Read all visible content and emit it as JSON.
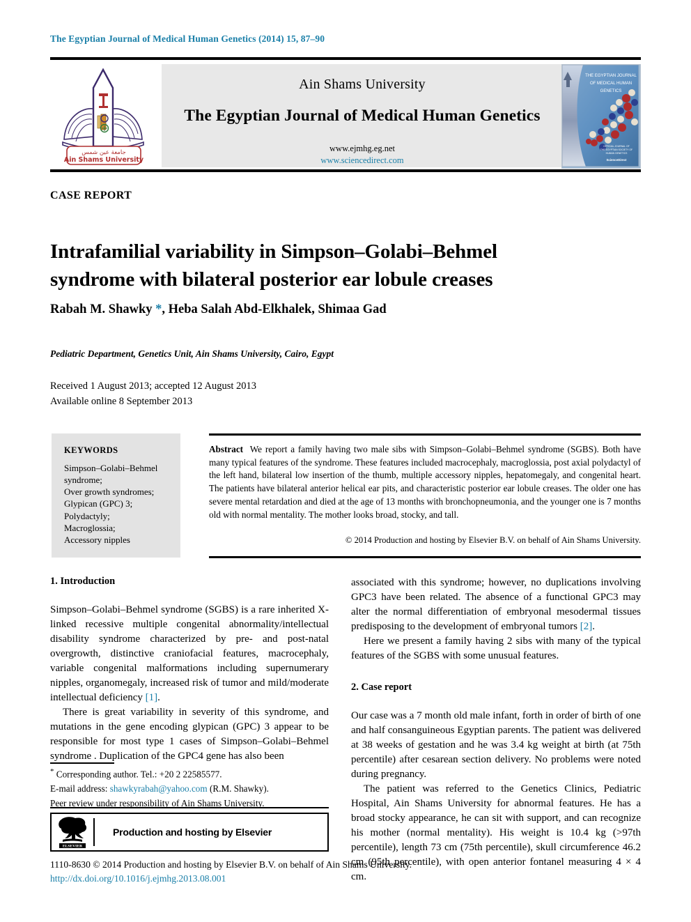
{
  "running_head": "The Egyptian Journal of Medical Human Genetics (2014) 15, 87–90",
  "masthead": {
    "university": "Ain Shams University",
    "journal_title": "The Egyptian Journal of Medical Human Genetics",
    "url_journal": "www.ejmhg.eg.net",
    "url_sciencedirect": "www.sciencedirect.com",
    "logo_caption_arabic": "جامعة عين شمس",
    "logo_caption": "Ain Shams University",
    "cover_title_line1": "THE EGYPTIAN JOURNAL",
    "cover_title_line2": "OF MEDICAL HUMAN",
    "cover_title_line3": "GENETICS"
  },
  "article": {
    "type_label": "CASE REPORT",
    "title": "Intrafamilial variability in Simpson–Golabi–Behmel syndrome with bilateral posterior ear lobule creases",
    "authors_before_star": "Rabah M. Shawky ",
    "author_star": "*",
    "authors_after_star": ", Heba Salah Abd-Elkhalek, Shimaa Gad",
    "affiliation": "Pediatric Department, Genetics Unit, Ain Shams University, Cairo, Egypt",
    "received_line": "Received 1 August 2013; accepted 12 August 2013",
    "available_line": "Available online 8 September 2013"
  },
  "keywords": {
    "heading": "KEYWORDS",
    "items": [
      "Simpson–Golabi–Behmel syndrome;",
      "Over growth syndromes;",
      "Glypican (GPC) 3;",
      "Polydactyly;",
      "Macroglossia;",
      "Accessory nipples"
    ]
  },
  "abstract": {
    "label": "Abstract",
    "text": "We report a family having two male sibs with Simpson–Golabi–Behmel syndrome (SGBS). Both have many typical features of the syndrome. These features included macrocephaly, macroglossia, post axial polydactyl of the left hand, bilateral low insertion of the thumb, multiple accessory nipples, hepatomegaly, and congenital heart. The patients have bilateral anterior helical ear pits, and characteristic posterior ear lobule creases. The older one has severe mental retardation and died at the age of 13 months with bronchopneumonia, and the younger one is 7 months old with normal mentality. The mother looks broad, stocky, and tall.",
    "copyright": "© 2014 Production and hosting by Elsevier B.V. on behalf of Ain Shams University."
  },
  "sections": {
    "introduction_heading": "1. Introduction",
    "intro_p1_a": "Simpson–Golabi–Behmel syndrome (SGBS) is a rare inherited X-linked recessive multiple congenital abnormality/intellectual disability syndrome characterized by pre- and post-natal overgrowth, distinctive craniofacial features, macrocephaly, variable congenital malformations including supernumerary nipples, organomegaly, increased risk of tumor and mild/moderate intellectual deficiency ",
    "intro_p1_cite": "[1]",
    "intro_p1_b": ".",
    "intro_p2": "There is great variability in severity of this syndrome, and mutations in the gene encoding glypican (GPC) 3 appear to be responsible for most type 1 cases of Simpson–Golabi–Behmel syndrome . Duplication of the GPC4 gene has also been",
    "intro_p3_a": "associated with this syndrome; however, no duplications involving GPC3 have been related. The absence of a functional GPC3 may alter the normal differentiation of embryonal mesodermal tissues predisposing to the development of embryonal tumors ",
    "intro_p3_cite": "[2]",
    "intro_p3_b": ".",
    "intro_p4": "Here we present a family having 2 sibs with many of the typical features of the SGBS with some unusual features.",
    "case_report_heading": "2. Case report",
    "case_p1": "Our case was a 7 month old male infant, forth in order of birth of one and half consanguineous Egyptian parents. The patient was delivered at 38 weeks of gestation and he was 3.4 kg weight at birth (at 75th percentile) after cesarean section delivery. No problems were noted during pregnancy.",
    "case_p2": "The patient was referred to the Genetics Clinics, Pediatric Hospital, Ain Shams University for abnormal features. He has a broad stocky appearance, he can sit with support, and can recognize his mother (normal mentality). His weight is 10.4 kg (>97th percentile), length 73 cm (75th percentile), skull circumference 46.2 cm (95th percentile), with open anterior fontanel measuring 4 × 4 cm."
  },
  "footnotes": {
    "star": "*",
    "corresponding": " Corresponding author. Tel.: +20 2 22585577.",
    "email_label": "E-mail address: ",
    "email": "shawkyrabah@yahoo.com",
    "email_suffix": " (R.M. Shawky).",
    "peer_review": "Peer review under responsibility of Ain Shams University."
  },
  "elsevier": {
    "text": "Production and hosting by Elsevier",
    "wordmark": "ELSEVIER"
  },
  "bottom": {
    "copyright": "1110-8630 © 2014 Production and hosting by Elsevier B.V. on behalf of Ain Shams University.",
    "doi": "http://dx.doi.org/10.1016/j.ejmhg.2013.08.001"
  },
  "colors": {
    "link": "#1a7fa8",
    "masthead_bg": "#e8e8e8",
    "keyword_bg": "#e3e3e3"
  }
}
